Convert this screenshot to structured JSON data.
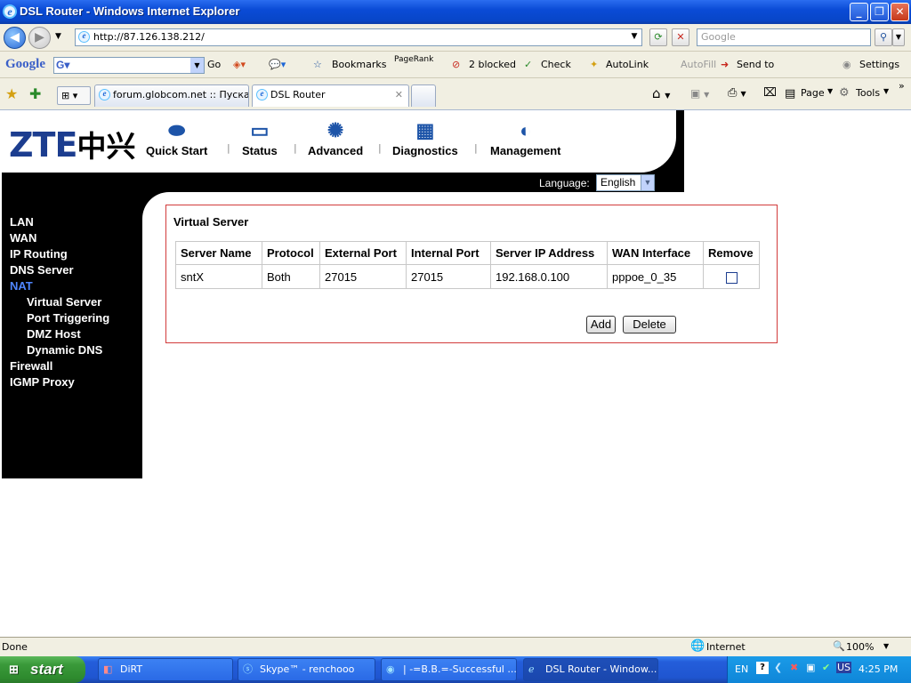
{
  "window": {
    "title": "DSL Router - Windows Internet Explorer",
    "min": "_",
    "max": "❐",
    "close": "✕"
  },
  "address": {
    "url": "http://87.126.138.212/",
    "search_placeholder": "Google"
  },
  "google_toolbar": {
    "logo": "Google",
    "go": "Go",
    "bookmarks": "Bookmarks",
    "pagerank": "PageRank",
    "blocked": "2 blocked",
    "check": "Check",
    "autolink": "AutoLink",
    "autofill": "AutoFill",
    "sendto": "Send to",
    "settings": "Settings"
  },
  "tabs": [
    {
      "label": "forum.globcom.net :: Пуска..."
    },
    {
      "label": "DSL Router"
    }
  ],
  "command_bar": {
    "page": "Page",
    "tools": "Tools"
  },
  "router": {
    "logo_latin": "ZTE",
    "logo_cn": "中兴",
    "nav": [
      {
        "label": "Quick Start",
        "icon": "quick-start-icon"
      },
      {
        "label": "Status",
        "icon": "status-icon"
      },
      {
        "label": "Advanced",
        "icon": "advanced-icon"
      },
      {
        "label": "Diagnostics",
        "icon": "diagnostics-icon"
      },
      {
        "label": "Management",
        "icon": "management-icon"
      }
    ],
    "language_label": "Language:",
    "language_value": "English",
    "sidebar": [
      {
        "label": "LAN"
      },
      {
        "label": "WAN"
      },
      {
        "label": "IP Routing"
      },
      {
        "label": "DNS Server"
      },
      {
        "label": "NAT"
      },
      {
        "label": "Virtual Server"
      },
      {
        "label": "Port Triggering"
      },
      {
        "label": "DMZ Host"
      },
      {
        "label": "Dynamic DNS"
      },
      {
        "label": "Firewall"
      },
      {
        "label": "IGMP Proxy"
      }
    ],
    "panel_title": "Virtual Server",
    "columns": [
      "Server Name",
      "Protocol",
      "External Port",
      "Internal Port",
      "Server IP Address",
      "WAN Interface",
      "Remove"
    ],
    "rows": [
      {
        "server_name": "sntX",
        "protocol": "Both",
        "external_port": "27015",
        "internal_port": "27015",
        "server_ip": "192.168.0.100",
        "wan_interface": "pppoe_0_35"
      }
    ],
    "add_label": "Add",
    "delete_label": "Delete"
  },
  "statusbar": {
    "text": "Done",
    "zone": "Internet",
    "zoom": "100%"
  },
  "taskbar": {
    "start": "start",
    "tasks": [
      {
        "label": "DiRT"
      },
      {
        "label": "Skype™ - renchooo"
      },
      {
        "label": "| -=B.B.=-Successful ..."
      },
      {
        "label": "DSL Router - Window..."
      }
    ],
    "lang": "EN",
    "lang2": "US",
    "clock": "4:25 PM"
  }
}
